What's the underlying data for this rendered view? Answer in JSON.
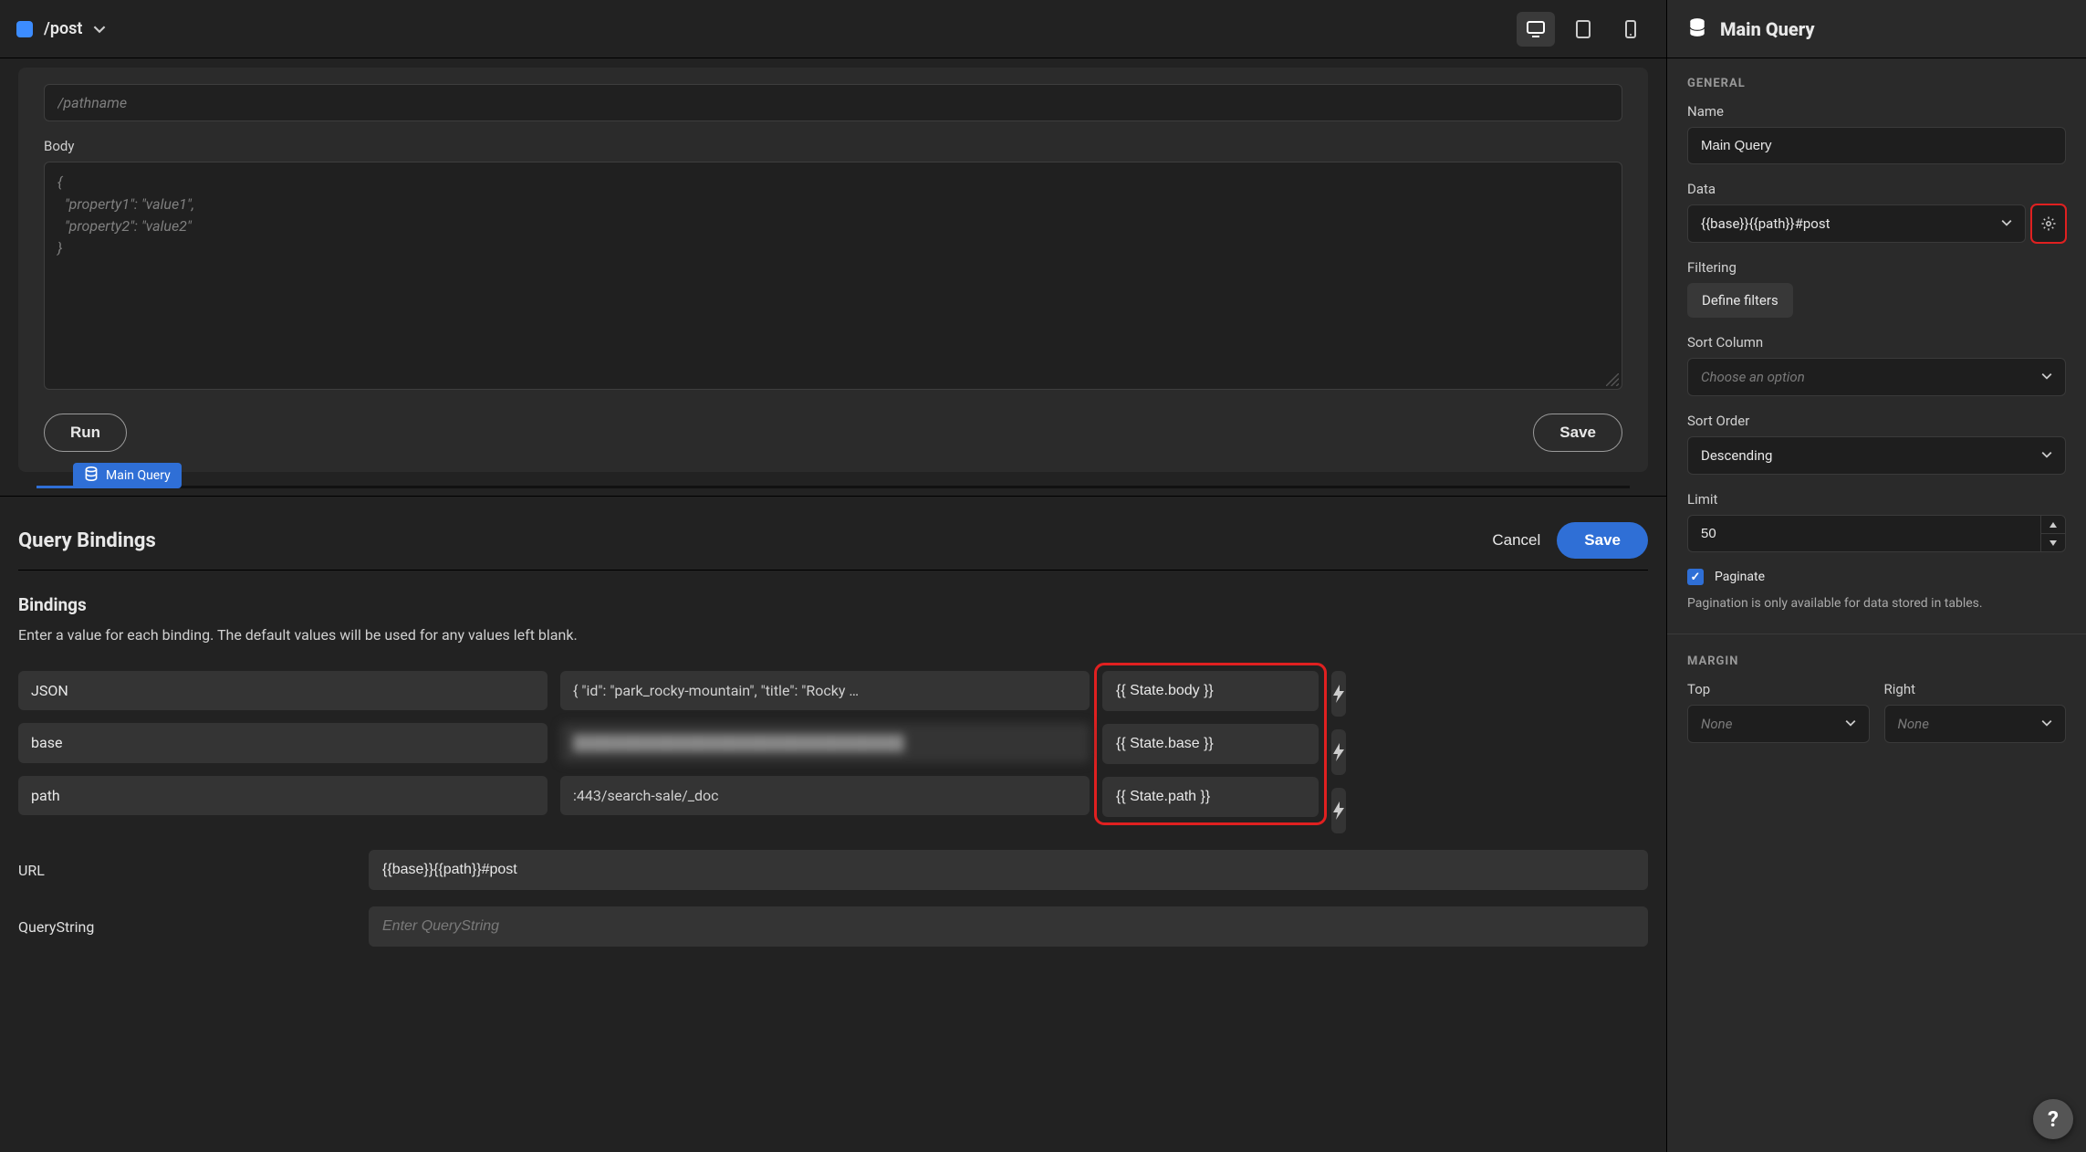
{
  "topbar": {
    "crumb": "/post",
    "devices": [
      "desktop",
      "tablet",
      "mobile"
    ],
    "active_device": "desktop"
  },
  "editor": {
    "pathname_placeholder": "/pathname",
    "body_label": "Body",
    "body_placeholder": "{\n  \"property1\": \"value1\",\n  \"property2\": \"value2\"\n}",
    "run_label": "Run",
    "save_label": "Save",
    "pill_label": "Main Query"
  },
  "bindings": {
    "title": "Query Bindings",
    "cancel_label": "Cancel",
    "save_label": "Save",
    "section_title": "Bindings",
    "section_hint": "Enter a value for each binding. The default values will be used for any values left blank.",
    "rows": [
      {
        "name": "JSON",
        "default": "{   \"id\": \"park_rocky-mountain\",   \"title\": \"Rocky   …",
        "state": "{{ State.body }}",
        "blurred": false
      },
      {
        "name": "base",
        "default": "████████████████████████████████",
        "state": "{{ State.base }}",
        "blurred": true
      },
      {
        "name": "path",
        "default": ":443/search-sale/_doc",
        "state": "{{ State.path }}",
        "blurred": false
      }
    ],
    "url_label": "URL",
    "url_value": "{{base}}{{path}}#post",
    "qs_label": "QueryString",
    "qs_placeholder": "Enter QueryString"
  },
  "side": {
    "title": "Main Query",
    "general_label": "General",
    "name_label": "Name",
    "name_value": "Main Query",
    "data_label": "Data",
    "data_value": "{{base}}{{path}}#post",
    "filtering_label": "Filtering",
    "define_filters": "Define filters",
    "sort_col_label": "Sort Column",
    "sort_col_placeholder": "Choose an option",
    "sort_order_label": "Sort Order",
    "sort_order_value": "Descending",
    "limit_label": "Limit",
    "limit_value": "50",
    "paginate_label": "Paginate",
    "paginate_hint": "Pagination is only available for data stored in tables.",
    "margin_label": "Margin",
    "margin_top_label": "Top",
    "margin_right_label": "Right",
    "margin_none": "None"
  },
  "help": "?"
}
